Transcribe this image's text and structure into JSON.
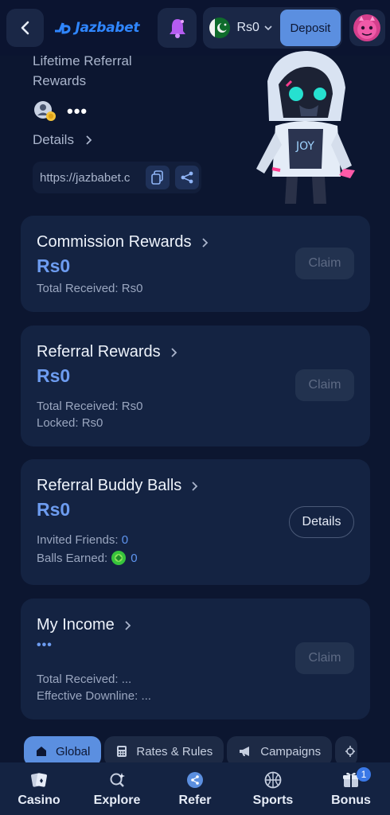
{
  "header": {
    "logo_text": "Jazbabet",
    "balance": "Rs0",
    "deposit_label": "Deposit"
  },
  "hero": {
    "title": "Lifetime Referral Rewards",
    "details_label": "Details",
    "referral_url": "https://jazbabet.c"
  },
  "cards": {
    "commission": {
      "title": "Commission Rewards",
      "amount": "Rs0",
      "total_label": "Total Received:",
      "total_value": "Rs0",
      "claim_label": "Claim"
    },
    "referral": {
      "title": "Referral Rewards",
      "amount": "Rs0",
      "total_label": "Total Received:",
      "total_value": "Rs0",
      "locked_label": "Locked:",
      "locked_value": "Rs0",
      "claim_label": "Claim"
    },
    "buddy": {
      "title": "Referral Buddy Balls",
      "amount": "Rs0",
      "invited_label": "Invited Friends:",
      "invited_value": "0",
      "balls_label": "Balls Earned:",
      "balls_value": "0",
      "details_label": "Details"
    },
    "income": {
      "title": "My Income",
      "total_label": "Total Received: ...",
      "downline_label": "Effective Downline: ...",
      "claim_label": "Claim"
    }
  },
  "tabs": [
    {
      "label": "Global",
      "icon": "home-icon",
      "active": true
    },
    {
      "label": "Rates & Rules",
      "icon": "calculator-icon",
      "active": false
    },
    {
      "label": "Campaigns",
      "icon": "megaphone-icon",
      "active": false
    }
  ],
  "bottom_nav": [
    {
      "label": "Casino",
      "icon": "cards-icon"
    },
    {
      "label": "Explore",
      "icon": "explore-icon"
    },
    {
      "label": "Refer",
      "icon": "share-icon"
    },
    {
      "label": "Sports",
      "icon": "basketball-icon"
    },
    {
      "label": "Bonus",
      "icon": "gift-icon",
      "badge": "1"
    }
  ],
  "colors": {
    "background": "#0c1630",
    "card": "#142342",
    "accent": "#5b8fe0",
    "amount": "#6d9cf0"
  }
}
